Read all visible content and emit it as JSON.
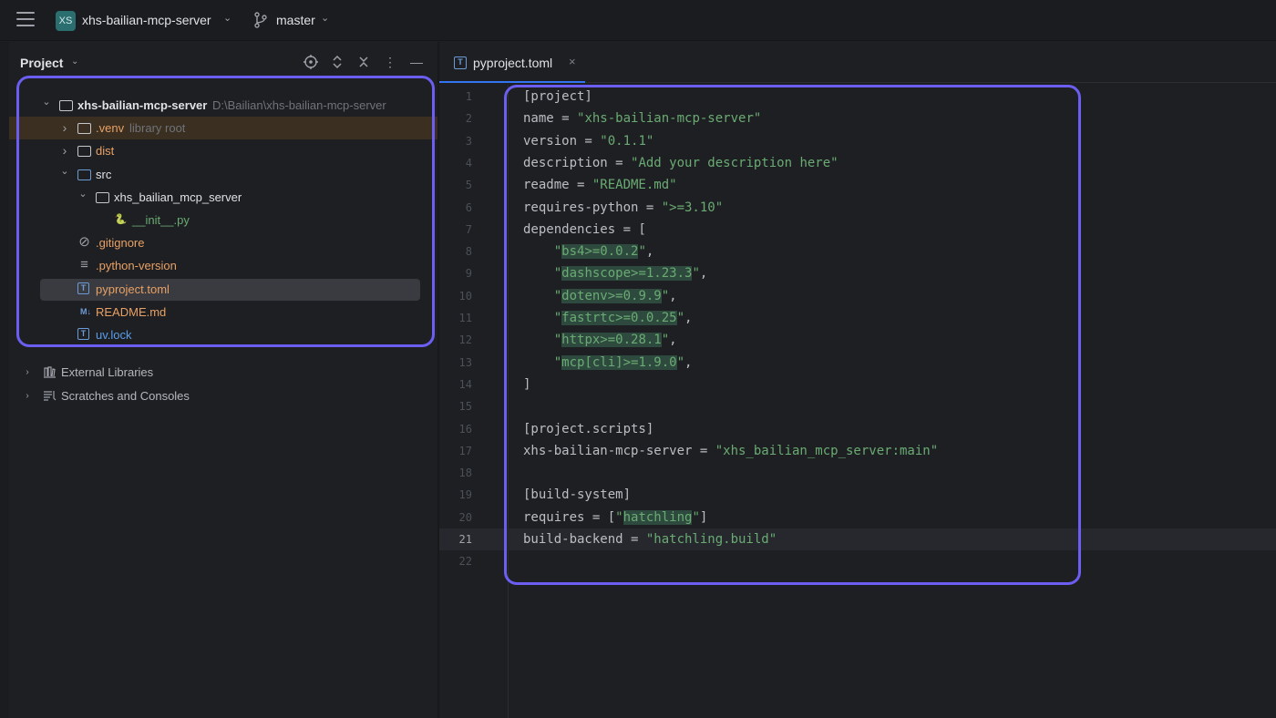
{
  "titlebar": {
    "project_badge": "XS",
    "project_name": "xhs-bailian-mcp-server",
    "branch": "master"
  },
  "panel": {
    "title": "Project"
  },
  "tree": [
    {
      "label": "xhs-bailian-mcp-server",
      "sub": "D:\\Bailian\\xhs-bailian-mcp-server",
      "kind": "folder",
      "depth": 0,
      "arrow": "⌄"
    },
    {
      "label": ".venv",
      "sub": "library root",
      "kind": "folder",
      "depth": 1,
      "arrow": "›"
    },
    {
      "label": "dist",
      "sub": "",
      "kind": "folder",
      "depth": 1,
      "arrow": "›"
    },
    {
      "label": "src",
      "sub": "",
      "kind": "folder-blue",
      "depth": 1,
      "arrow": "⌄"
    },
    {
      "label": "xhs_bailian_mcp_server",
      "sub": "",
      "kind": "package",
      "depth": 2,
      "arrow": "⌄"
    },
    {
      "label": "__init__.py",
      "sub": "",
      "kind": "python",
      "depth": 3,
      "arrow": ""
    },
    {
      "label": ".gitignore",
      "sub": "",
      "kind": "ignore",
      "depth": 1,
      "arrow": ""
    },
    {
      "label": ".python-version",
      "sub": "",
      "kind": "text",
      "depth": 1,
      "arrow": ""
    },
    {
      "label": "pyproject.toml",
      "sub": "",
      "kind": "toml",
      "depth": 1,
      "arrow": ""
    },
    {
      "label": "README.md",
      "sub": "",
      "kind": "md",
      "depth": 1,
      "arrow": ""
    },
    {
      "label": "uv.lock",
      "sub": "",
      "kind": "toml",
      "depth": 1,
      "arrow": ""
    }
  ],
  "external_libraries": "External Libraries",
  "scratches": "Scratches and Consoles",
  "editor": {
    "tab_label": "pyproject.toml",
    "tab_icon": "T",
    "current_line": 21,
    "lines": [
      "[project]",
      "name = \"xhs-bailian-mcp-server\"",
      "version = \"0.1.1\"",
      "description = \"Add your description here\"",
      "readme = \"README.md\"",
      "requires-python = \">=3.10\"",
      "dependencies = [",
      "    \"bs4>=0.0.2\",",
      "    \"dashscope>=1.23.3\",",
      "    \"dotenv>=0.9.9\",",
      "    \"fastrtc>=0.0.25\",",
      "    \"httpx>=0.28.1\",",
      "    \"mcp[cli]>=1.9.0\",",
      "]",
      "",
      "[project.scripts]",
      "xhs-bailian-mcp-server = \"xhs_bailian_mcp_server:main\"",
      "",
      "[build-system]",
      "requires = [\"hatchling\"]",
      "build-backend = \"hatchling.build\"",
      ""
    ]
  },
  "colors": {
    "accent": "#3574f0",
    "annotation": "#6b5ef0",
    "string": "#6aab73",
    "venv_row": "#3a2f21",
    "vcs_modified": "#e8a165",
    "vcs_added": "#5a9ee8"
  },
  "icons": [
    "hamburger-menu-icon",
    "branch-icon",
    "locate-icon",
    "expand-collapse-icon",
    "close-icon",
    "more-options-icon",
    "minimize-icon",
    "folder-icon",
    "python-file-icon",
    "toml-file-icon",
    "markdown-file-icon",
    "ignore-file-icon",
    "text-file-icon",
    "library-icon",
    "scratches-icon"
  ]
}
